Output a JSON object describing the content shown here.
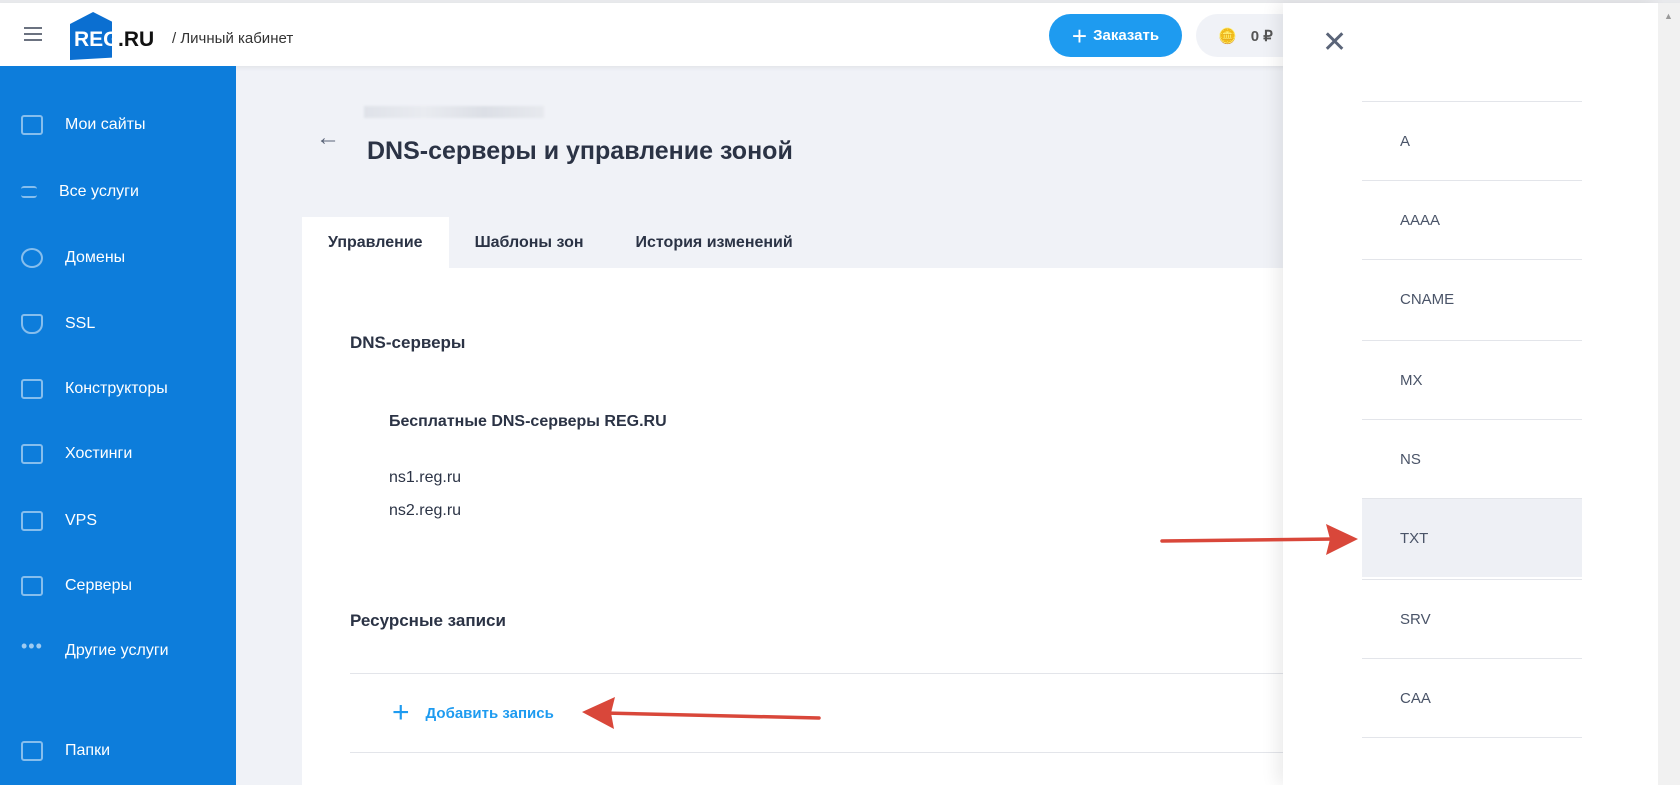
{
  "header": {
    "brand_logo": "REG.RU",
    "breadcrumb": "/ Личный кабинет",
    "order_button": "Заказать",
    "balance": "0 ₽"
  },
  "sidebar": {
    "items": [
      {
        "label": "Мои сайты",
        "icon": "sites-icon"
      },
      {
        "label": "Все услуги",
        "icon": "list-icon"
      },
      {
        "label": "Домены",
        "icon": "globe-icon"
      },
      {
        "label": "SSL",
        "icon": "shield-lock-icon"
      },
      {
        "label": "Конструкторы",
        "icon": "builder-icon"
      },
      {
        "label": "Хостинги",
        "icon": "hosting-icon"
      },
      {
        "label": "VPS",
        "icon": "vps-icon"
      },
      {
        "label": "Серверы",
        "icon": "server-icon"
      },
      {
        "label": "Другие услуги",
        "icon": "dots-icon"
      },
      {
        "label": "Папки",
        "icon": "folder-icon"
      }
    ]
  },
  "page": {
    "title": "DNS-серверы и управление зоной",
    "tabs": [
      "Управление",
      "Шаблоны зон",
      "История изменений"
    ],
    "dns_section": "DNS-серверы",
    "free_dns_title": "Бесплатные DNS-серверы REG.RU",
    "ns": [
      "ns1.reg.ru",
      "ns2.reg.ru"
    ],
    "records_section": "Ресурсные записи",
    "add_record": "Добавить запись"
  },
  "panel": {
    "record_types": [
      "A",
      "AAAA",
      "CNAME",
      "MX",
      "NS",
      "TXT",
      "SRV",
      "CAA"
    ],
    "highlighted": "TXT"
  },
  "colors": {
    "sidebar": "#0d7ddb",
    "accent": "#1e9bf0",
    "annotation_arrow": "#d9473a"
  }
}
